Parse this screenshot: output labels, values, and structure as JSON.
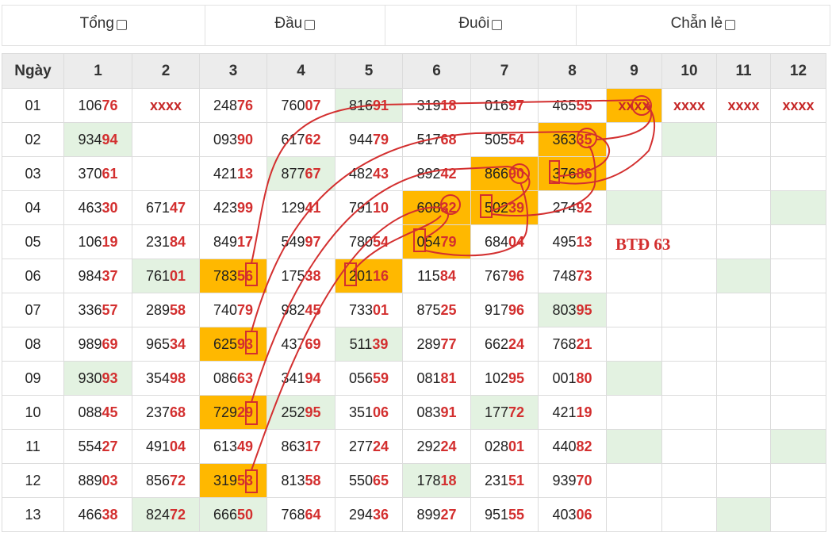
{
  "filters": [
    {
      "label": "Tổng"
    },
    {
      "label": "Đầu"
    },
    {
      "label": "Đuôi"
    },
    {
      "label": "Chẵn lẻ"
    }
  ],
  "columns": [
    "Ngày",
    "1",
    "2",
    "3",
    "4",
    "5",
    "6",
    "7",
    "8",
    "9",
    "10",
    "11",
    "12"
  ],
  "annotation": "BTĐ 63",
  "rows": [
    {
      "day": "01",
      "cells": [
        {
          "v": "10676"
        },
        {
          "v": "xxxx"
        },
        {
          "v": "24876"
        },
        {
          "v": "76007"
        },
        {
          "v": "81691",
          "h": "g"
        },
        {
          "v": "31918"
        },
        {
          "v": "01697"
        },
        {
          "v": "46555"
        },
        {
          "v": "xxxx",
          "h": "o"
        },
        {
          "v": "xxxx"
        },
        {
          "v": "xxxx"
        },
        {
          "v": "xxxx"
        }
      ]
    },
    {
      "day": "02",
      "cells": [
        {
          "v": "93494",
          "h": "g"
        },
        {
          "v": ""
        },
        {
          "v": "09390"
        },
        {
          "v": "61762"
        },
        {
          "v": "94479"
        },
        {
          "v": "51768"
        },
        {
          "v": "50554"
        },
        {
          "v": "36335",
          "h": "o"
        },
        {
          "v": ""
        },
        {
          "v": "",
          "h": "g"
        },
        {
          "v": ""
        },
        {
          "v": ""
        }
      ]
    },
    {
      "day": "03",
      "cells": [
        {
          "v": "37061"
        },
        {
          "v": ""
        },
        {
          "v": "42113"
        },
        {
          "v": "87767",
          "h": "g"
        },
        {
          "v": "48243"
        },
        {
          "v": "89242"
        },
        {
          "v": "86690",
          "h": "o"
        },
        {
          "v": "37686",
          "h": "o"
        },
        {
          "v": ""
        },
        {
          "v": ""
        },
        {
          "v": ""
        },
        {
          "v": ""
        }
      ]
    },
    {
      "day": "04",
      "cells": [
        {
          "v": "46330"
        },
        {
          "v": "67147"
        },
        {
          "v": "42399"
        },
        {
          "v": "12941"
        },
        {
          "v": "79110"
        },
        {
          "v": "60832",
          "h": "o"
        },
        {
          "v": "50239",
          "h": "o"
        },
        {
          "v": "27492"
        },
        {
          "v": "",
          "h": "g"
        },
        {
          "v": ""
        },
        {
          "v": ""
        },
        {
          "v": "",
          "h": "g"
        }
      ]
    },
    {
      "day": "05",
      "cells": [
        {
          "v": "10619"
        },
        {
          "v": "23184"
        },
        {
          "v": "84917"
        },
        {
          "v": "54997"
        },
        {
          "v": "78054"
        },
        {
          "v": "05479",
          "h": "o"
        },
        {
          "v": "68404"
        },
        {
          "v": "49513"
        },
        {
          "v": ""
        },
        {
          "v": ""
        },
        {
          "v": ""
        },
        {
          "v": ""
        }
      ]
    },
    {
      "day": "06",
      "cells": [
        {
          "v": "98437"
        },
        {
          "v": "76101",
          "h": "g"
        },
        {
          "v": "78356",
          "h": "o"
        },
        {
          "v": "17538"
        },
        {
          "v": "20116",
          "h": "o"
        },
        {
          "v": "11584"
        },
        {
          "v": "76796"
        },
        {
          "v": "74873"
        },
        {
          "v": ""
        },
        {
          "v": ""
        },
        {
          "v": "",
          "h": "g"
        },
        {
          "v": ""
        }
      ]
    },
    {
      "day": "07",
      "cells": [
        {
          "v": "33657"
        },
        {
          "v": "28958"
        },
        {
          "v": "74079"
        },
        {
          "v": "98245"
        },
        {
          "v": "73301"
        },
        {
          "v": "87525"
        },
        {
          "v": "91796"
        },
        {
          "v": "80395",
          "h": "g"
        },
        {
          "v": ""
        },
        {
          "v": ""
        },
        {
          "v": ""
        },
        {
          "v": ""
        }
      ]
    },
    {
      "day": "08",
      "cells": [
        {
          "v": "98969"
        },
        {
          "v": "96534"
        },
        {
          "v": "62593",
          "h": "o"
        },
        {
          "v": "43769"
        },
        {
          "v": "51139",
          "h": "g"
        },
        {
          "v": "28977"
        },
        {
          "v": "66224"
        },
        {
          "v": "76821"
        },
        {
          "v": ""
        },
        {
          "v": ""
        },
        {
          "v": ""
        },
        {
          "v": ""
        }
      ]
    },
    {
      "day": "09",
      "cells": [
        {
          "v": "93093",
          "h": "g"
        },
        {
          "v": "35498"
        },
        {
          "v": "08663"
        },
        {
          "v": "34194"
        },
        {
          "v": "05659"
        },
        {
          "v": "08181"
        },
        {
          "v": "10295"
        },
        {
          "v": "00180"
        },
        {
          "v": "",
          "h": "g"
        },
        {
          "v": ""
        },
        {
          "v": ""
        },
        {
          "v": ""
        }
      ]
    },
    {
      "day": "10",
      "cells": [
        {
          "v": "08845"
        },
        {
          "v": "23768"
        },
        {
          "v": "72929",
          "h": "o"
        },
        {
          "v": "25295",
          "h": "g"
        },
        {
          "v": "35106"
        },
        {
          "v": "08391"
        },
        {
          "v": "17772",
          "h": "g"
        },
        {
          "v": "42119"
        },
        {
          "v": ""
        },
        {
          "v": ""
        },
        {
          "v": ""
        },
        {
          "v": ""
        }
      ]
    },
    {
      "day": "11",
      "cells": [
        {
          "v": "55427"
        },
        {
          "v": "49104"
        },
        {
          "v": "61349"
        },
        {
          "v": "86317"
        },
        {
          "v": "27724"
        },
        {
          "v": "29224"
        },
        {
          "v": "02801"
        },
        {
          "v": "44082"
        },
        {
          "v": "",
          "h": "g"
        },
        {
          "v": ""
        },
        {
          "v": ""
        },
        {
          "v": "",
          "h": "g"
        }
      ]
    },
    {
      "day": "12",
      "cells": [
        {
          "v": "88903"
        },
        {
          "v": "85672"
        },
        {
          "v": "31953",
          "h": "o"
        },
        {
          "v": "81358"
        },
        {
          "v": "55065"
        },
        {
          "v": "17818",
          "h": "g"
        },
        {
          "v": "23151"
        },
        {
          "v": "93970"
        },
        {
          "v": ""
        },
        {
          "v": ""
        },
        {
          "v": ""
        },
        {
          "v": ""
        }
      ]
    },
    {
      "day": "13",
      "cells": [
        {
          "v": "46638"
        },
        {
          "v": "82472",
          "h": "g"
        },
        {
          "v": "66650",
          "h": "g"
        },
        {
          "v": "76864"
        },
        {
          "v": "29436"
        },
        {
          "v": "89927"
        },
        {
          "v": "95155"
        },
        {
          "v": "40306"
        },
        {
          "v": ""
        },
        {
          "v": ""
        },
        {
          "v": "",
          "h": "g"
        },
        {
          "v": ""
        }
      ]
    }
  ]
}
